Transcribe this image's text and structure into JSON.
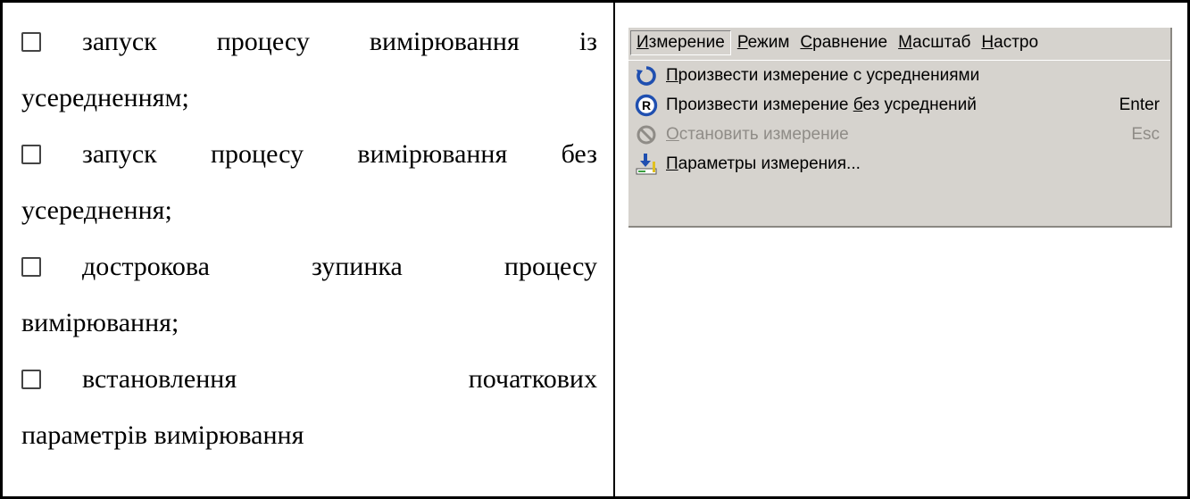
{
  "options": [
    {
      "line1": [
        "запуск",
        "процесу",
        "вимірювання",
        "із"
      ],
      "line2": "усередненням;"
    },
    {
      "line1": [
        "запуск",
        "процесу",
        "вимірювання",
        "без"
      ],
      "line2": "усереднення;"
    },
    {
      "line1": [
        "дострокова",
        "зупинка",
        "процесу"
      ],
      "line2": "вимірювання;"
    },
    {
      "line1": [
        "встановлення",
        "початкових"
      ],
      "line2": "параметрів вимірювання"
    }
  ],
  "menu": {
    "bar": [
      {
        "label": "Измерение",
        "u": "И",
        "rest": "змерение"
      },
      {
        "label": "Режим",
        "u": "Р",
        "rest": "ежим"
      },
      {
        "label": "Сравнение",
        "u": "С",
        "rest": "равнение"
      },
      {
        "label": "Масштаб",
        "u": "М",
        "rest": "асштаб"
      },
      {
        "label": "Настро",
        "u": "Н",
        "rest": "астро"
      }
    ],
    "items": [
      {
        "pre": "",
        "u": "П",
        "post": "роизвести измерение с усреднениями",
        "shortcut": "",
        "icon": "refresh-icon",
        "disabled": false
      },
      {
        "pre": "Произвести измерение ",
        "u": "б",
        "post": "ез усреднений",
        "shortcut": "Enter",
        "icon": "registered-icon",
        "disabled": false
      },
      {
        "pre": "",
        "u": "О",
        "post": "становить измерение",
        "shortcut": "Esc",
        "icon": "stop-icon",
        "disabled": true
      },
      {
        "pre": "",
        "u": "П",
        "post": "араметры измерения...",
        "shortcut": "",
        "icon": "parameters-icon",
        "disabled": false
      }
    ],
    "colors": {
      "background": "#d6d3ce",
      "icon_blue": "#1f4fb0",
      "disabled": "#8f8c87"
    }
  }
}
